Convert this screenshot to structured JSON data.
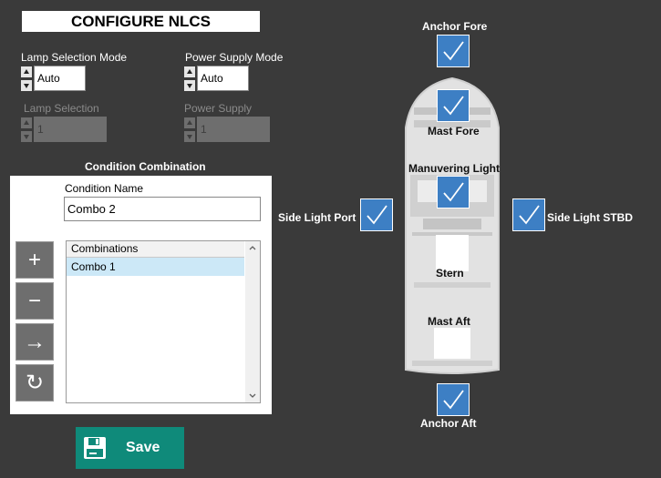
{
  "header": {
    "title": "CONFIGURE NLCS"
  },
  "lamp_selection_mode": {
    "label": "Lamp Selection Mode",
    "value": "Auto"
  },
  "power_supply_mode": {
    "label": "Power Supply Mode",
    "value": "Auto"
  },
  "lamp_selection": {
    "label": "Lamp Selection",
    "value": "1"
  },
  "power_supply": {
    "label": "Power Supply",
    "value": "1"
  },
  "condition_combination": {
    "title": "Condition Combination",
    "name_label": "Condition Name",
    "name_value": "Combo 2",
    "list_header": "Combinations",
    "items": [
      "Combo 1"
    ],
    "buttons": {
      "add": "+",
      "remove": "−",
      "apply": "→",
      "refresh": "↻"
    }
  },
  "save": {
    "label": "Save"
  },
  "lights": {
    "anchor_fore": {
      "label": "Anchor Fore",
      "checked": true
    },
    "mast_fore": {
      "label": "Mast Fore",
      "checked": true
    },
    "manuvering": {
      "label": "Manuvering Light",
      "checked": true
    },
    "side_port": {
      "label": "Side Light  Port",
      "checked": true
    },
    "side_stbd": {
      "label": "Side Light STBD",
      "checked": true
    },
    "stern": {
      "label": "Stern",
      "checked": false
    },
    "mast_aft": {
      "label": "Mast Aft",
      "checked": false
    },
    "anchor_aft": {
      "label": "Anchor Aft",
      "checked": true
    }
  },
  "colors": {
    "background": "#3a3a3a",
    "accent": "#3d7fc4",
    "save": "#0f8a7a"
  }
}
